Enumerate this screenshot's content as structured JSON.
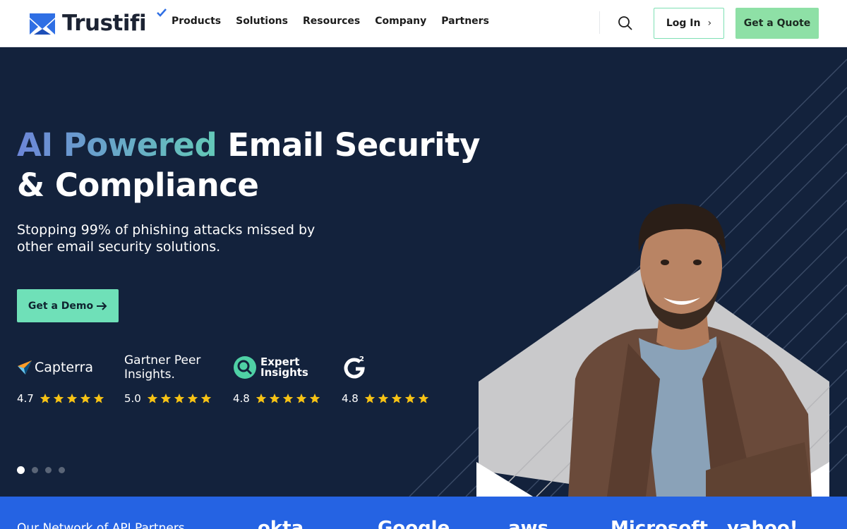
{
  "header": {
    "logo_text": "Trustifi",
    "nav": [
      "Products",
      "Solutions",
      "Resources",
      "Company",
      "Partners"
    ],
    "login_label": "Log In",
    "quote_label": "Get a Quote"
  },
  "hero": {
    "headline_accent": "AI Powered",
    "headline_rest": " Email Security & Compliance",
    "subtext": "Stopping 99% of phishing attacks missed by other email security solutions.",
    "demo_label": "Get a Demo",
    "ratings": [
      {
        "name": "Capterra",
        "score": "4.7",
        "stars": 5
      },
      {
        "name": "Gartner Peer Insights.",
        "score": "5.0",
        "stars": 5
      },
      {
        "name": "Expert Insights",
        "score": "4.8",
        "stars": 5
      },
      {
        "name": "G2",
        "score": "4.8",
        "stars": 5
      }
    ],
    "carousel": {
      "count": 4,
      "active": 0
    }
  },
  "partners": {
    "label": "Our Network of API Partners",
    "logos": [
      "okta",
      "Google",
      "aws",
      "Microsoft",
      "yahoo!"
    ]
  },
  "colors": {
    "hero_bg": "#13223c",
    "accent_green": "#6fe0b8",
    "quote_green": "#8ee0a6",
    "partner_blue": "#2563e3",
    "star_yellow": "#f7c315"
  }
}
